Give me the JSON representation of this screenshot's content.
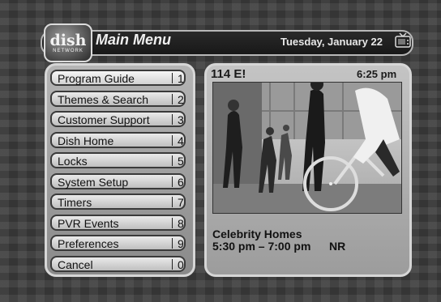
{
  "header": {
    "logo_main": "dish",
    "logo_sub": "NETWORK",
    "title": "Main Menu",
    "date": "Tuesday, January 22",
    "tv_icon": "tv-icon"
  },
  "menu": {
    "items": [
      {
        "label": "Program Guide",
        "number": "1"
      },
      {
        "label": "Themes & Search",
        "number": "2"
      },
      {
        "label": "Customer Support",
        "number": "3"
      },
      {
        "label": "Dish Home",
        "number": "4"
      },
      {
        "label": "Locks",
        "number": "5"
      },
      {
        "label": "System Setup",
        "number": "6"
      },
      {
        "label": "Timers",
        "number": "7"
      },
      {
        "label": "PVR Events",
        "number": "8"
      },
      {
        "label": "Preferences",
        "number": "9"
      },
      {
        "label": "Cancel",
        "number": "0"
      }
    ],
    "selected_index": 0
  },
  "preview": {
    "channel": "114 E!",
    "time": "6:25 pm",
    "show_title": "Celebrity Homes",
    "show_time": "5:30 pm – 7:00 pm",
    "rating": "NR"
  }
}
